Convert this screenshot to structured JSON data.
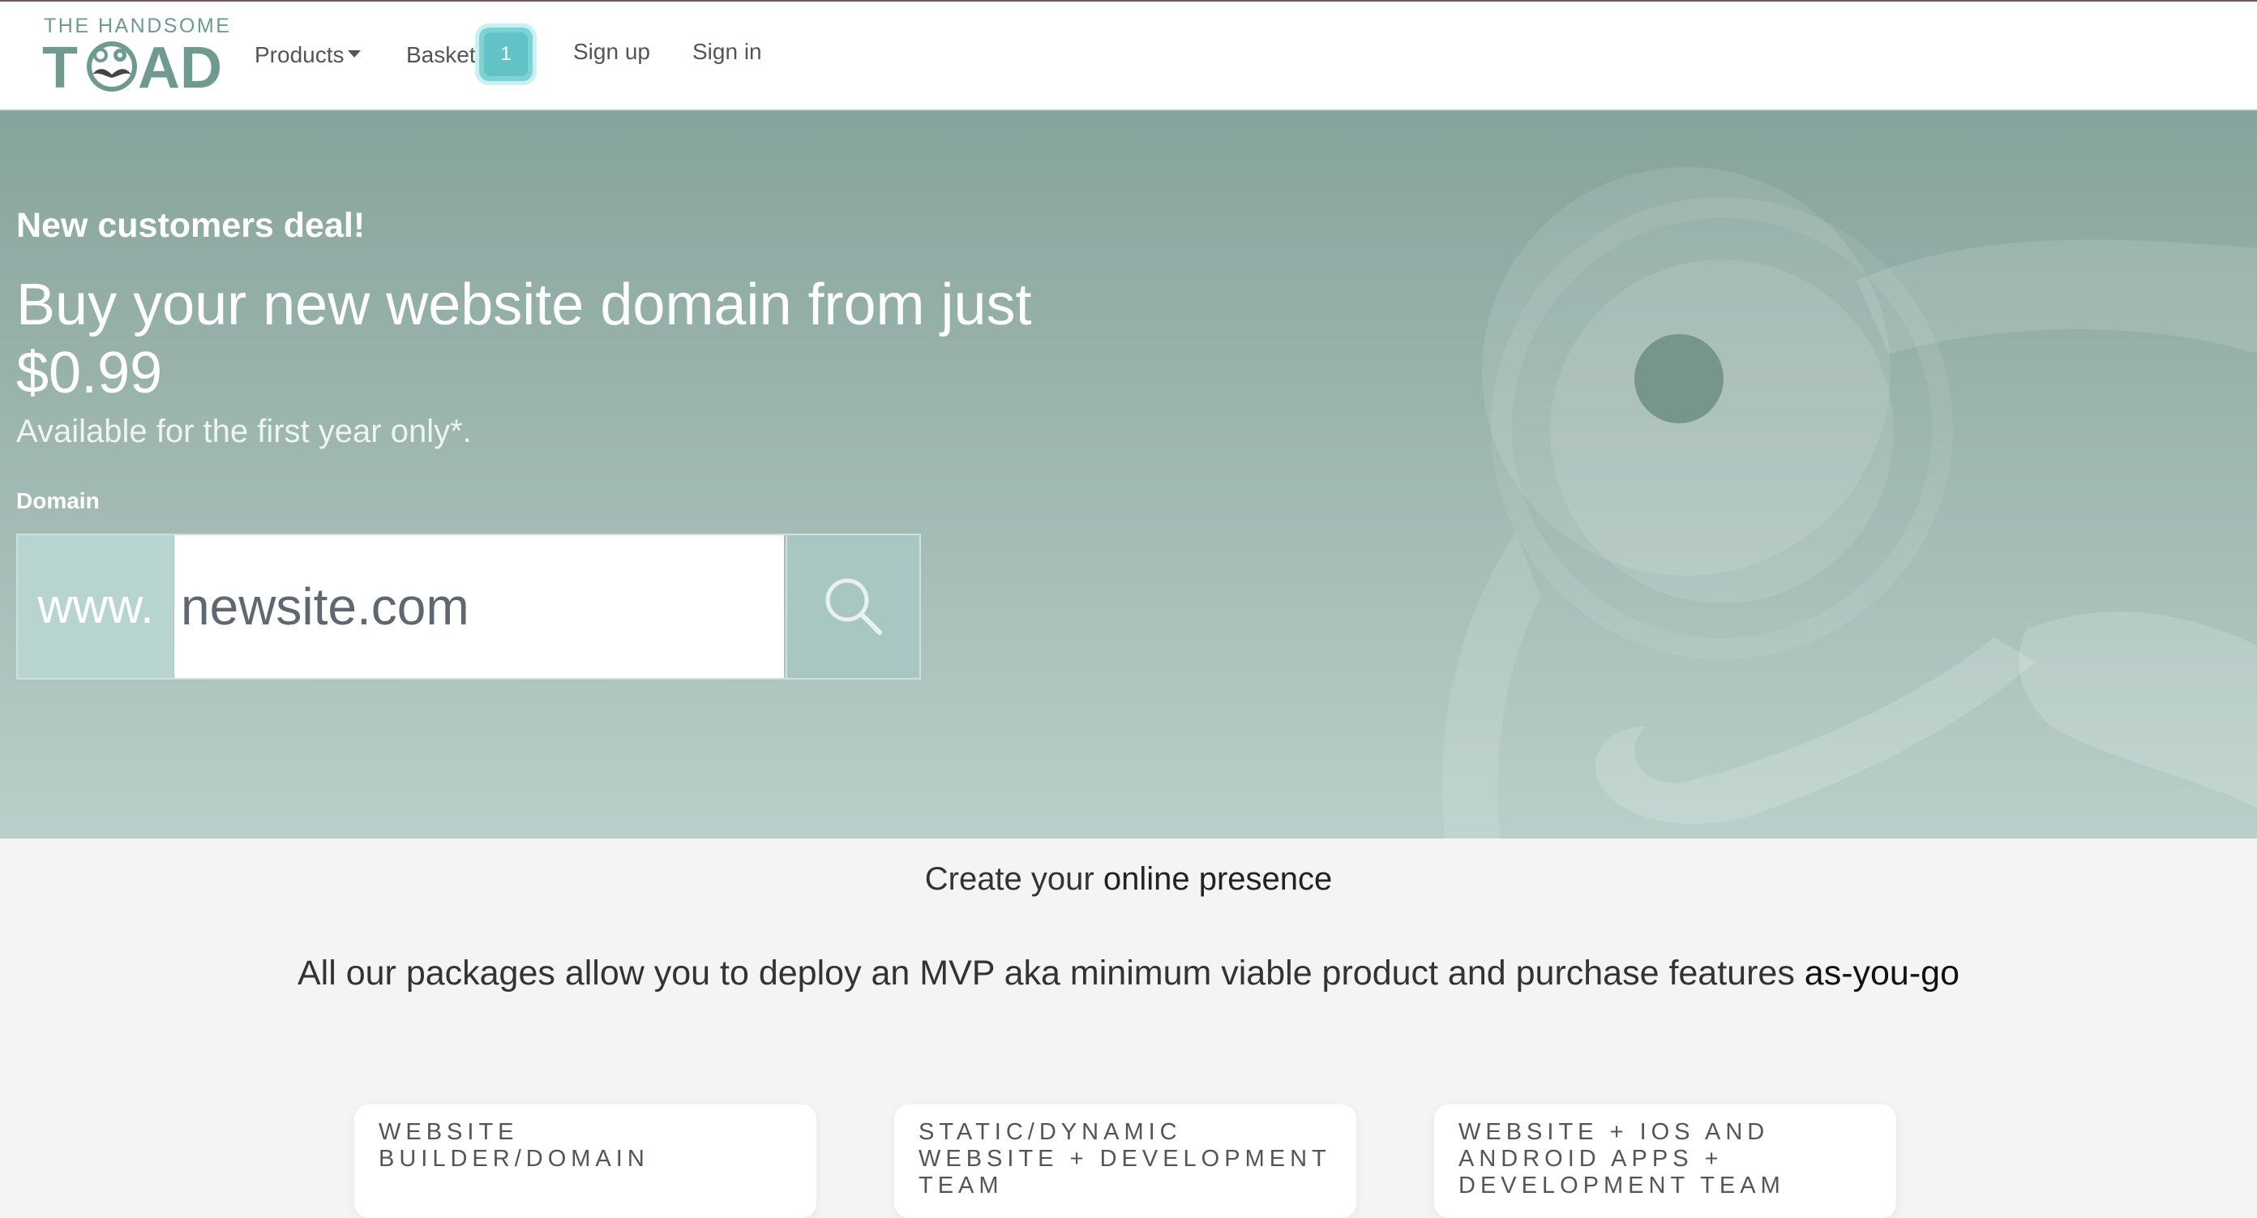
{
  "brand": {
    "top_text": "THE HANDSOME",
    "word_left": "T",
    "word_right": "AD"
  },
  "nav": {
    "products": "Products",
    "basket": "Basket",
    "basket_count": "1",
    "signup": "Sign up",
    "signin": "Sign in"
  },
  "hero": {
    "deal": "New customers deal!",
    "headline": "Buy your new website domain from just $0.99",
    "subline": "Available for the first year only*.",
    "domain_label": "Domain",
    "prefix": "www.",
    "input_value": "newsite.com"
  },
  "content": {
    "tagline_plain": "Create your ",
    "tagline_bold": "online presence",
    "packages_plain": "All our packages allow you to deploy an MVP aka minimum viable product and purchase features ",
    "packages_bold": "as-you-go"
  },
  "cards": [
    {
      "title": "Website Builder/Domain"
    },
    {
      "title": "Static/Dynamic Website + Development Team"
    },
    {
      "title": "Website + iOS and Android Apps + Development Team"
    }
  ],
  "colors": {
    "hero_top": "#86a49b",
    "hero_bottom": "#b9cfca",
    "badge": "#62c3c6",
    "brand": "#6e9a90"
  }
}
